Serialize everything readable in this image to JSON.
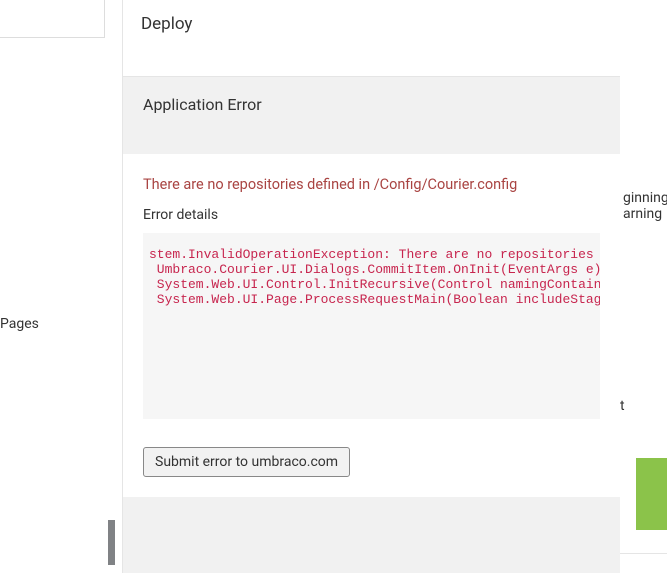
{
  "left": {
    "nav_label": "Pages"
  },
  "header": {
    "title": "Deploy"
  },
  "subheader": {
    "title": "Application Error"
  },
  "error": {
    "title": "There are no repositories defined in /Config/Courier.config",
    "details_label": "Error details",
    "stacktrace": "stem.InvalidOperationException: There are no repositories defined\n Umbraco.Courier.UI.Dialogs.CommitItem.OnInit(EventArgs e)\n System.Web.UI.Control.InitRecursive(Control namingContainer)\n System.Web.UI.Page.ProcessRequestMain(Boolean includeStagesBefore"
  },
  "actions": {
    "submit_label": "Submit error to umbraco.com"
  },
  "right": {
    "frag1": "ginning",
    "frag2": "arning",
    "frag3": "t"
  }
}
